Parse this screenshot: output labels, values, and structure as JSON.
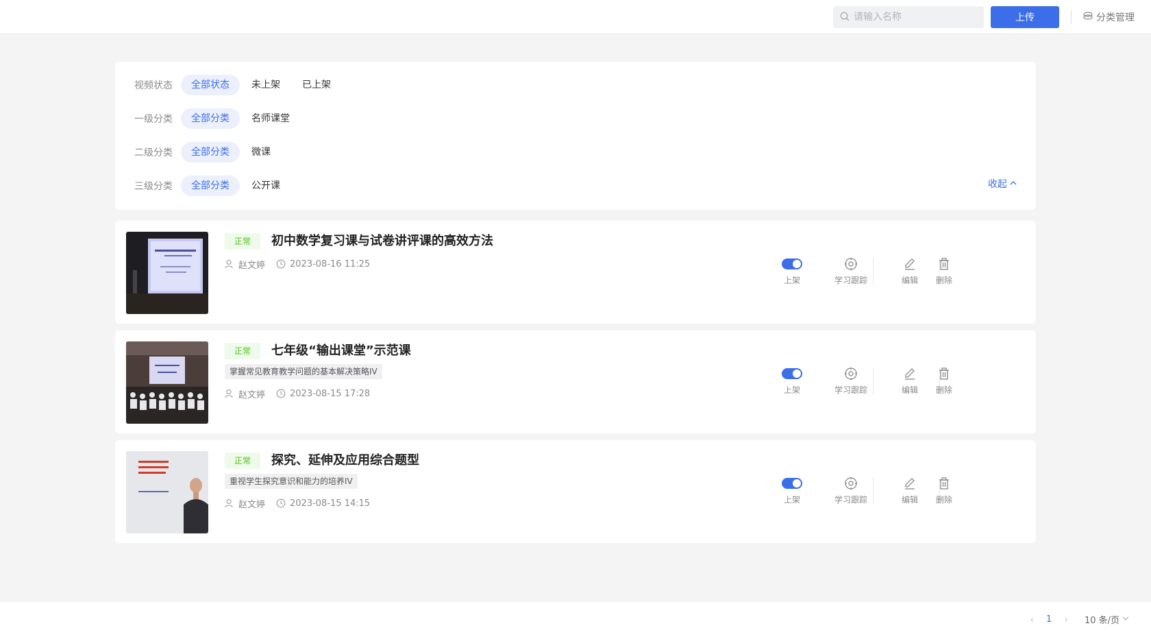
{
  "header": {
    "search_placeholder": "请输入名称",
    "upload_label": "上传",
    "category_manage_label": "分类管理"
  },
  "filters": {
    "rows": [
      {
        "label": "视频状态",
        "options": [
          "全部状态",
          "未上架",
          "已上架"
        ],
        "active": 0
      },
      {
        "label": "一级分类",
        "options": [
          "全部分类",
          "名师课堂"
        ],
        "active": 0
      },
      {
        "label": "二级分类",
        "options": [
          "全部分类",
          "微课"
        ],
        "active": 0
      },
      {
        "label": "三级分类",
        "options": [
          "全部分类",
          "公开课"
        ],
        "active": 0
      }
    ],
    "collapse_label": "收起"
  },
  "videos": [
    {
      "status": "正常",
      "title": "初中数学复习课与试卷讲评课的高效方法",
      "description": "",
      "author": "赵文婷",
      "datetime": "2023-08-16 11:25",
      "published": true
    },
    {
      "status": "正常",
      "title": "七年级“输出课堂”示范课",
      "description": "掌握常见教育教学问题的基本解决策略IV",
      "author": "赵文婷",
      "datetime": "2023-08-15 17:28",
      "published": true
    },
    {
      "status": "正常",
      "title": "探究、延伸及应用综合题型",
      "description": "重视学生探究意识和能力的培养IV",
      "author": "赵文婷",
      "datetime": "2023-08-15 14:15",
      "published": true
    }
  ],
  "actions": {
    "publish_label": "上架",
    "track_label": "学习跟踪",
    "edit_label": "编辑",
    "delete_label": "删除"
  },
  "pagination": {
    "current_page": "1",
    "page_size_label": "10 条/页"
  },
  "colors": {
    "accent": "#3b6ee8",
    "status_green": "#52c41a",
    "page_bg": "#f4f4f5"
  }
}
